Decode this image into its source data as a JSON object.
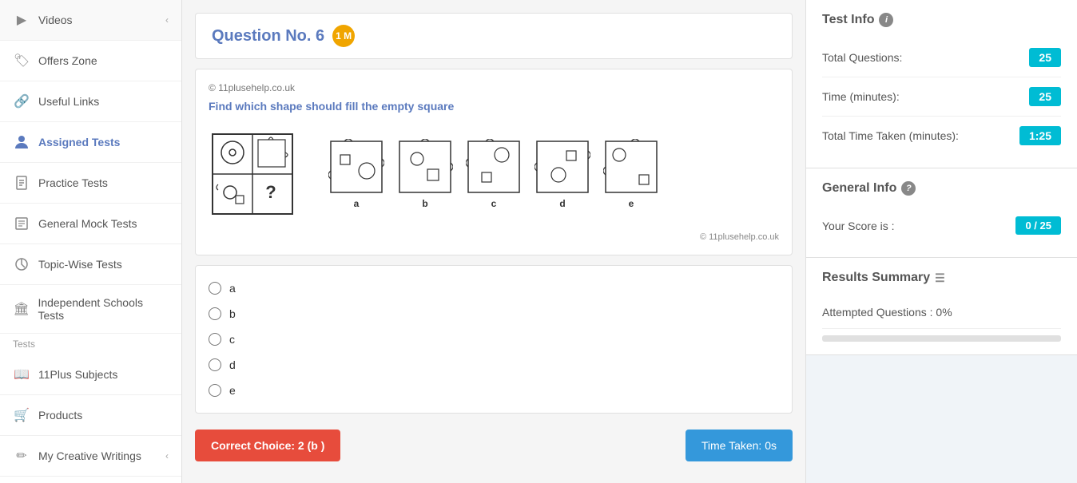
{
  "sidebar": {
    "items": [
      {
        "id": "videos",
        "label": "Videos",
        "icon": "▶",
        "hasChevron": true,
        "active": false
      },
      {
        "id": "offers-zone",
        "label": "Offers Zone",
        "icon": "🏷",
        "hasChevron": false,
        "active": false
      },
      {
        "id": "useful-links",
        "label": "Useful Links",
        "icon": "🔗",
        "hasChevron": false,
        "active": false
      },
      {
        "id": "assigned-tests",
        "label": "Assigned Tests",
        "icon": "👤",
        "hasChevron": false,
        "active": true
      },
      {
        "id": "practice-tests",
        "label": "Practice Tests",
        "icon": "📄",
        "hasChevron": false,
        "active": false
      },
      {
        "id": "general-mock-tests",
        "label": "General Mock Tests",
        "icon": "📝",
        "hasChevron": false,
        "active": false
      },
      {
        "id": "topic-wise-tests",
        "label": "Topic-Wise Tests",
        "icon": "🔄",
        "hasChevron": false,
        "active": false
      },
      {
        "id": "independent-schools",
        "label": "Independent Schools Tests",
        "icon": "🏛",
        "hasChevron": false,
        "active": false
      },
      {
        "id": "11plus-subjects",
        "label": "11Plus Subjects",
        "icon": "📖",
        "hasChevron": false,
        "active": false
      },
      {
        "id": "products",
        "label": "Products",
        "icon": "🛒",
        "hasChevron": false,
        "active": false
      },
      {
        "id": "my-creative-writings",
        "label": "My Creative Writings",
        "icon": "✏",
        "hasChevron": true,
        "active": false
      }
    ]
  },
  "question": {
    "number": "Question No. 6",
    "mark": "1 M",
    "copyright": "© 11plusehelp.co.uk",
    "instruction": "Find which shape should fill the empty square",
    "copyright_bottom": "© 11plusehelp.co.uk",
    "options": [
      "a",
      "b",
      "c",
      "d",
      "e"
    ]
  },
  "footer": {
    "correct_choice_label": "Correct Choice: 2 (b )",
    "time_taken_label": "Time Taken: 0s"
  },
  "right_panel": {
    "test_info_title": "Test Info",
    "total_questions_label": "Total Questions:",
    "total_questions_value": "25",
    "time_minutes_label": "Time (minutes):",
    "time_minutes_value": "25",
    "total_time_taken_label": "Total Time Taken (minutes):",
    "total_time_taken_value": "1:25",
    "general_info_title": "General Info",
    "your_score_label": "Your Score is :",
    "your_score_value": "0 / 25",
    "results_summary_title": "Results Summary",
    "attempted_questions_label": "Attempted Questions : 0%",
    "attempted_percent": 0
  }
}
